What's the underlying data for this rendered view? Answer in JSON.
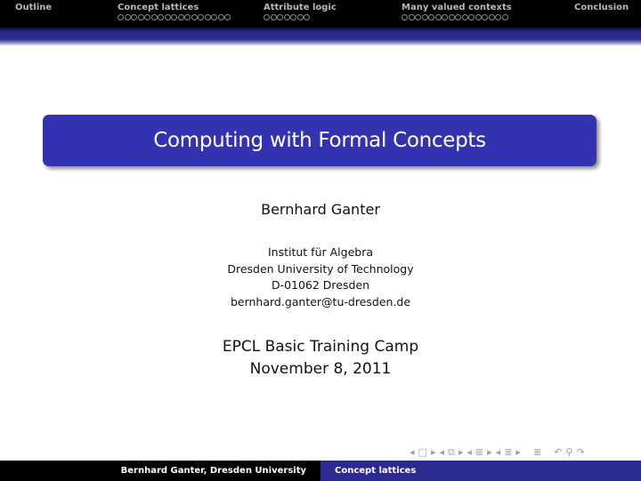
{
  "nav": {
    "sections": [
      {
        "label": "Outline",
        "dots": 0
      },
      {
        "label": "Concept lattices",
        "dots": 17
      },
      {
        "label": "Attribute logic",
        "dots": 7
      },
      {
        "label": "Many valued contexts",
        "dots": 16
      },
      {
        "label": "Conclusion",
        "dots": 0
      }
    ]
  },
  "title": "Computing with Formal Concepts",
  "author": "Bernhard Ganter",
  "institute": {
    "line1": "Institut für Algebra",
    "line2": "Dresden University of Technology",
    "line3": "D-01062 Dresden",
    "email": "bernhard.ganter@tu-dresden.de"
  },
  "event": {
    "name": "EPCL Basic Training Camp",
    "date": "November 8, 2011"
  },
  "beamer_nav": {
    "frame_prev": "◂",
    "frame_icon": "□",
    "frame_next": "▸",
    "sub_prev": "◂",
    "sub_icon": "⧉",
    "sub_next": "▸",
    "sec_prev": "◂",
    "sec_icon": "≣",
    "sec_next": "▸",
    "subsec_prev": "◂",
    "subsec_icon": "≣",
    "subsec_next": "▸",
    "align_icon": "≣",
    "back_icon": "↶",
    "search_icon": "⚲",
    "forward_icon": "↷"
  },
  "footer": {
    "author_inst": "Bernhard Ganter, Dresden University",
    "section": "Concept lattices"
  },
  "colors": {
    "theme_blue": "#3333b2",
    "header_bg": "#000000",
    "footer_blue": "#2b2b8f"
  }
}
